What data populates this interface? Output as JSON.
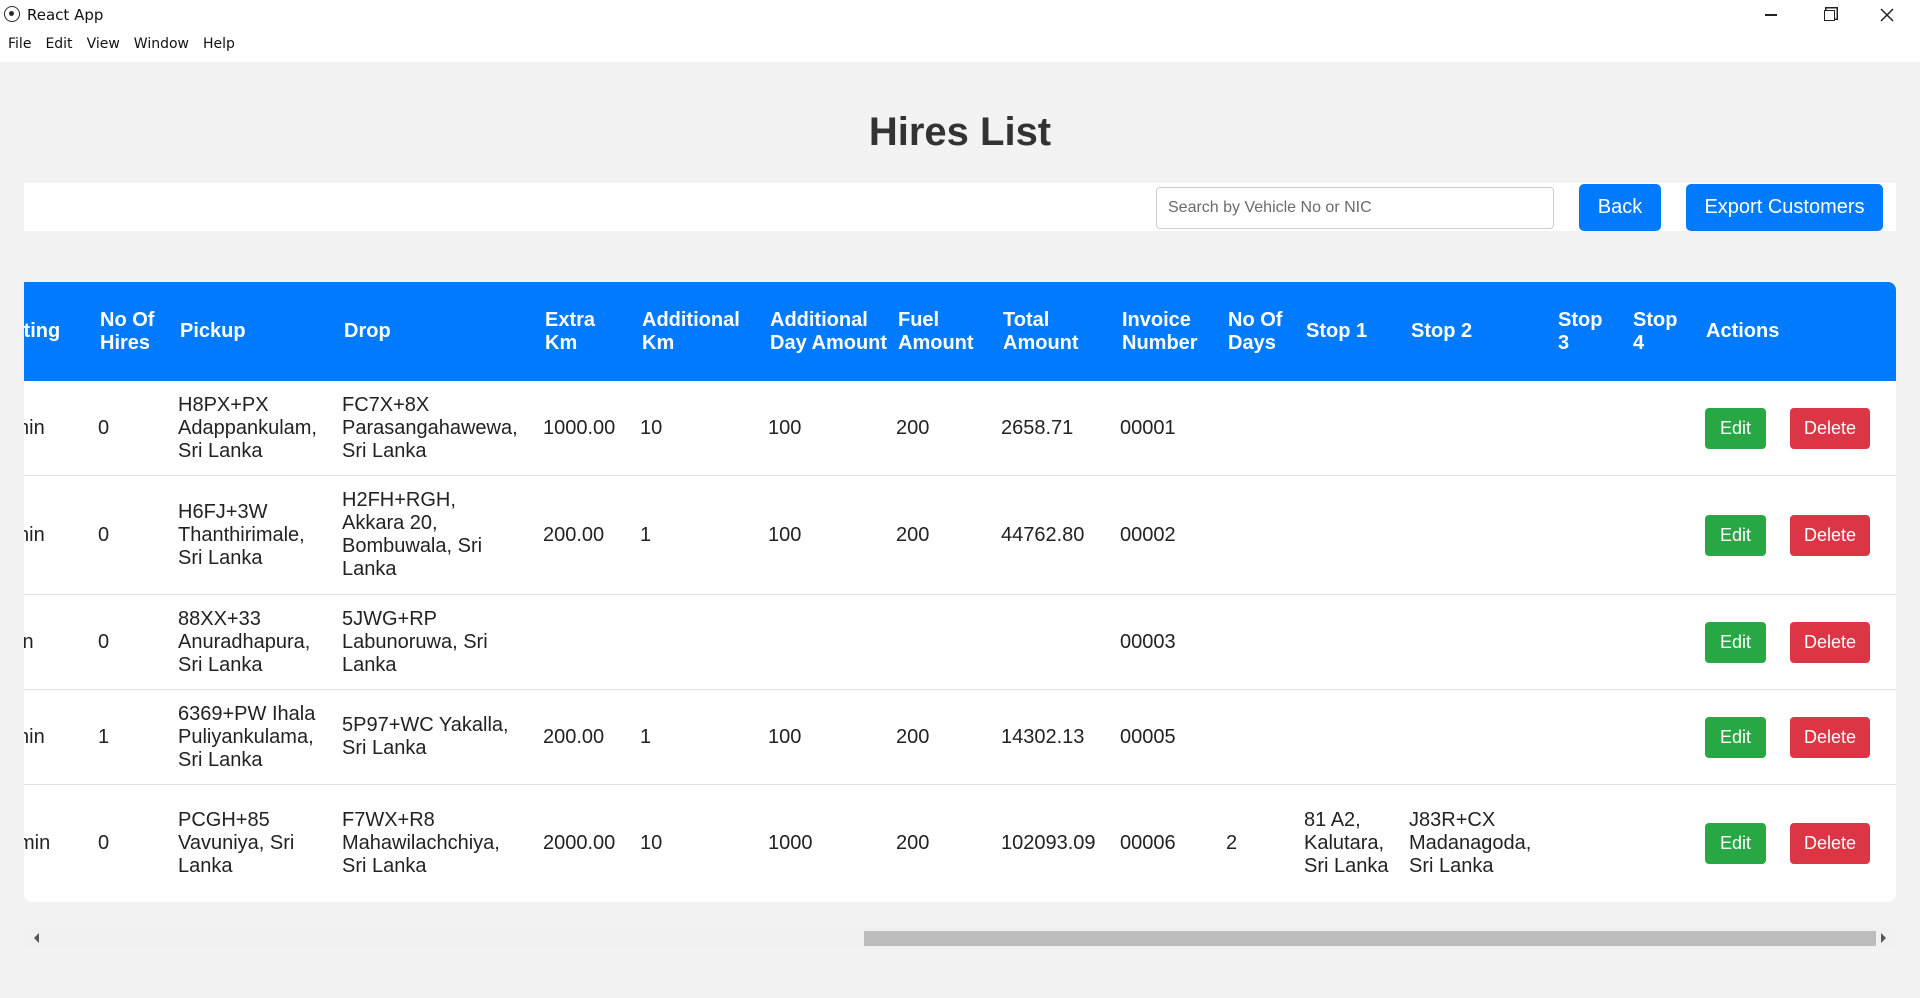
{
  "window": {
    "title": "React App",
    "menu": [
      "File",
      "Edit",
      "View",
      "Window",
      "Help"
    ]
  },
  "page": {
    "title": "Hires List",
    "search_placeholder": "Search by Vehicle No or NIC",
    "back_label": "Back",
    "export_label": "Export Customers"
  },
  "colors": {
    "primary": "#007bff",
    "edit": "#28a745",
    "delete": "#dc3545"
  },
  "table": {
    "headers": [
      "iting",
      "No Of Hires",
      "Pickup",
      "Drop",
      "Extra Km",
      "Additional Km",
      "Additional Day Amount",
      "Fuel Amount",
      "Total Amount",
      "Invoice Number",
      "No Of Days",
      "Stop 1",
      "Stop 2",
      "Stop 3",
      "Stop 4",
      "Actions"
    ],
    "rows": [
      {
        "waiting": "nin",
        "hires": "0",
        "pickup": "H8PX+PX Adappankulam, Sri Lanka",
        "drop": "FC7X+8X Parasangahawewa, Sri Lanka",
        "extra_km": "1000.00",
        "additional_km": "10",
        "additional_day": "100",
        "fuel": "200",
        "total": "2658.71",
        "invoice": "00001",
        "days": "",
        "stop1": "",
        "stop2": "",
        "stop3": "",
        "stop4": "",
        "edit": "Edit",
        "delete": "Delete"
      },
      {
        "waiting": "nin",
        "hires": "0",
        "pickup": "H6FJ+3W Thanthirimale, Sri Lanka",
        "drop": "H2FH+RGH, Akkara 20, Bombuwala, Sri Lanka",
        "extra_km": "200.00",
        "additional_km": "1",
        "additional_day": "100",
        "fuel": "200",
        "total": "44762.80",
        "invoice": "00002",
        "days": "",
        "stop1": "",
        "stop2": "",
        "stop3": "",
        "stop4": "",
        "edit": "Edit",
        "delete": "Delete"
      },
      {
        "waiting": "in",
        "hires": "0",
        "pickup": "88XX+33 Anuradhapura, Sri Lanka",
        "drop": "5JWG+RP Labunoruwa, Sri Lanka",
        "extra_km": "",
        "additional_km": "",
        "additional_day": "",
        "fuel": "",
        "total": "",
        "invoice": "00003",
        "days": "",
        "stop1": "",
        "stop2": "",
        "stop3": "",
        "stop4": "",
        "edit": "Edit",
        "delete": "Delete"
      },
      {
        "waiting": "nin",
        "hires": "1",
        "pickup": "6369+PW Ihala Puliyankulama, Sri Lanka",
        "drop": "5P97+WC Yakalla, Sri Lanka",
        "extra_km": "200.00",
        "additional_km": "1",
        "additional_day": "100",
        "fuel": "200",
        "total": "14302.13",
        "invoice": "00005",
        "days": "",
        "stop1": "",
        "stop2": "",
        "stop3": "",
        "stop4": "",
        "edit": "Edit",
        "delete": "Delete"
      },
      {
        "waiting": "min",
        "hires": "0",
        "pickup": "PCGH+85 Vavuniya, Sri Lanka",
        "drop": "F7WX+R8 Mahawilachchiya, Sri Lanka",
        "extra_km": "2000.00",
        "additional_km": "10",
        "additional_day": "1000",
        "fuel": "200",
        "total": "102093.09",
        "invoice": "00006",
        "days": "2",
        "stop1": "81 A2, Kalutara, Sri Lanka",
        "stop2": "J83R+CX Madanagoda, Sri Lanka",
        "stop3": "",
        "stop4": "",
        "edit": "Edit",
        "delete": "Delete"
      }
    ]
  }
}
